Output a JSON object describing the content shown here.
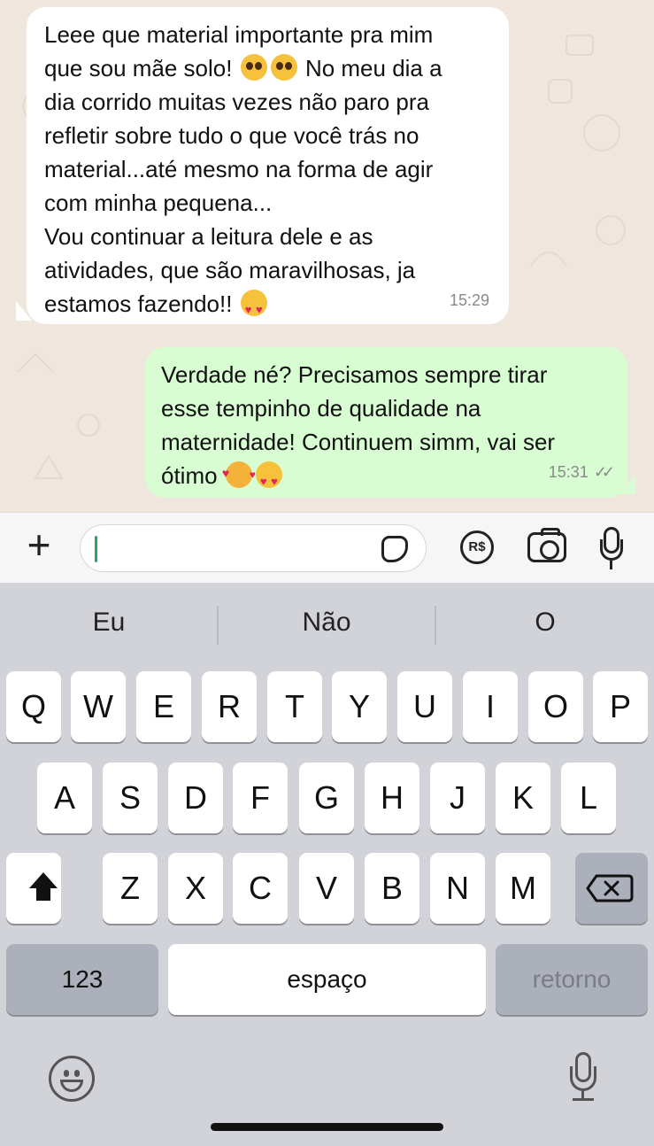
{
  "chat": {
    "incoming": {
      "text": "Leee que material importante pra mim\nque sou mãe solo!",
      "text_after_emoji": "No meu dia a\ndia corrido muitas vezes não paro pra\nrefletir sobre tudo o que você trás no\nmaterial...até mesmo na forma de agir\ncom minha pequena...\nVou continuar a leitura dele e as\natividades, que são maravilhosas, ja\nestamos fazendo!!",
      "time": "15:29"
    },
    "outgoing": {
      "text": "Verdade né? Precisamos sempre tirar\nesse tempinho de qualidade na\nmaternidade! Continuem simm, vai ser\nótimo",
      "time": "15:31",
      "status_icon": "double-check-icon"
    }
  },
  "input_bar": {
    "plus_label": "+",
    "message_value": "",
    "payment_label": "R$"
  },
  "keyboard": {
    "suggestions": [
      "Eu",
      "Não",
      "O"
    ],
    "row1": [
      "Q",
      "W",
      "E",
      "R",
      "T",
      "Y",
      "U",
      "I",
      "O",
      "P"
    ],
    "row2": [
      "A",
      "S",
      "D",
      "F",
      "G",
      "H",
      "J",
      "K",
      "L"
    ],
    "row3": [
      "Z",
      "X",
      "C",
      "V",
      "B",
      "N",
      "M"
    ],
    "numbers_label": "123",
    "space_label": "espaço",
    "return_label": "retorno"
  }
}
